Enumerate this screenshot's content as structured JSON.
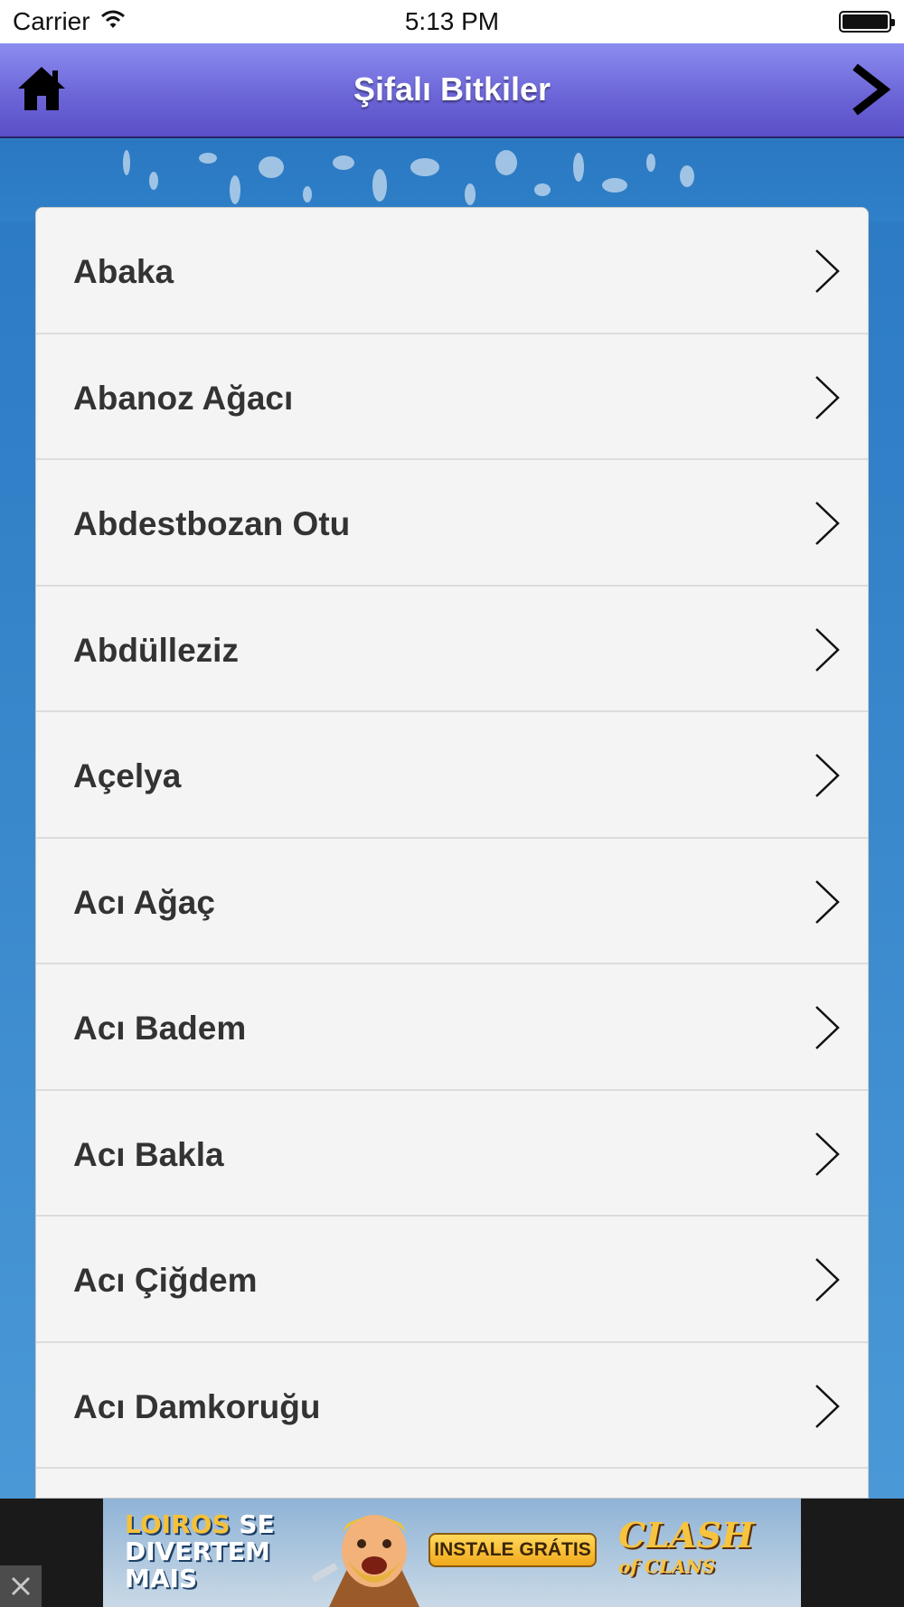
{
  "status_bar": {
    "carrier": "Carrier",
    "time": "5:13 PM"
  },
  "nav_bar": {
    "title": "Şifalı Bitkiler",
    "home_icon": "home-icon",
    "forward_icon": "chevron-right-icon"
  },
  "list": {
    "items": [
      {
        "label": "Abaka"
      },
      {
        "label": "Abanoz Ağacı"
      },
      {
        "label": "Abdestbozan Otu"
      },
      {
        "label": "Abdülleziz"
      },
      {
        "label": "Açelya"
      },
      {
        "label": "Acı Ağaç"
      },
      {
        "label": "Acı Badem"
      },
      {
        "label": "Acı Bakla"
      },
      {
        "label": "Acı Çiğdem"
      },
      {
        "label": "Acı Damkoruğu"
      }
    ]
  },
  "ad": {
    "slogan_highlight": "LOIROS",
    "slogan_rest": "SE DIVERTEM MAIS",
    "cta": "INSTALE GRÁTIS",
    "brand_line1": "CLASH",
    "brand_line2": "of CLANS"
  },
  "colors": {
    "nav_gradient_top": "#8b8cf0",
    "nav_gradient_bottom": "#5a4fc8",
    "background_blue": "#2f7dc4",
    "list_background": "#f4f4f4",
    "item_text": "#333333"
  }
}
